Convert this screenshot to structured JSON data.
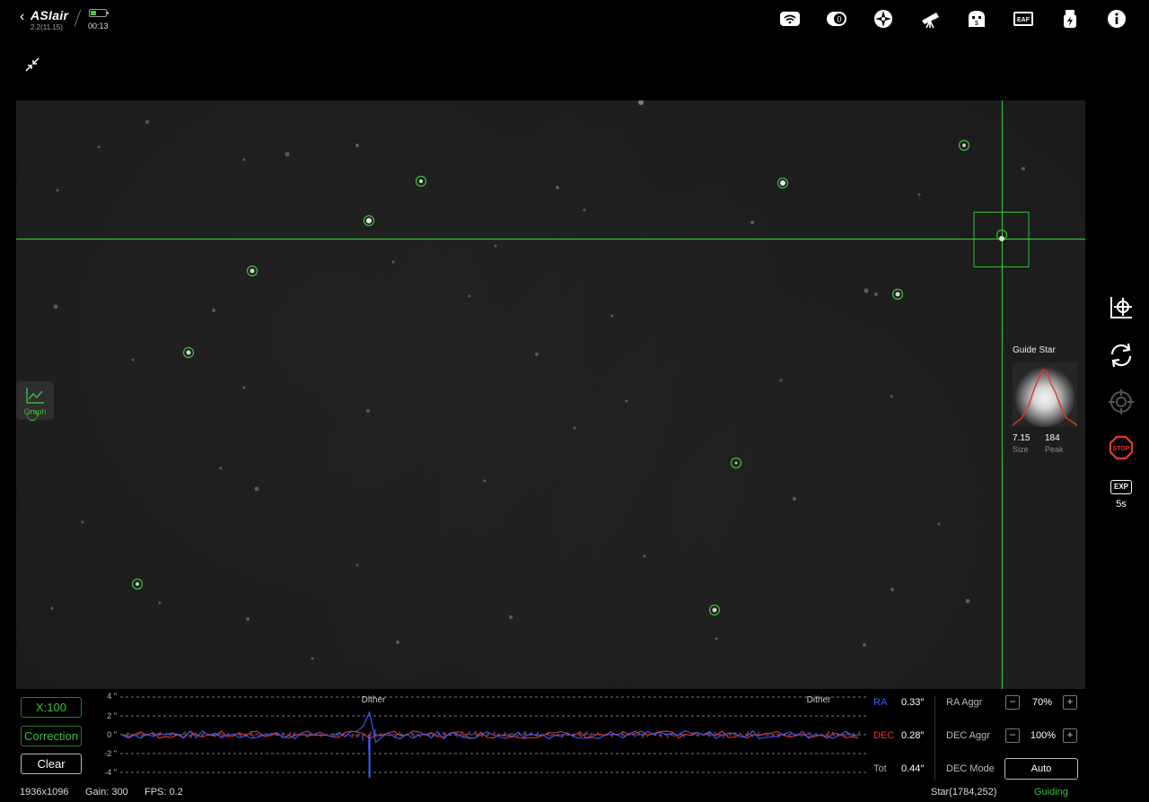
{
  "header": {
    "app_logo": "ASIair",
    "version": "2.2(11.15)",
    "elapsed": "00:13",
    "battery_level_pct": 40,
    "toolbar_icons": [
      "wifi-icon",
      "filter-wheel-icon",
      "guide-icon",
      "telescope-icon",
      "power-box-icon",
      "eaf-icon",
      "power-icon",
      "info-icon"
    ],
    "eaf_label": "EAF",
    "filter_label": "0"
  },
  "guide_view": {
    "graph_label": "Graph"
  },
  "guide_star": {
    "title": "Guide Star",
    "size_value": "7.15",
    "size_label": "Size",
    "peak_value": "184",
    "peak_label": "Peak"
  },
  "right_toolbar": {
    "items": [
      "calibrate-icon",
      "loop-icon",
      "target-icon",
      "stop-icon"
    ],
    "stop_label": "STOP",
    "exp_label": "EXP",
    "exp_value": "5s"
  },
  "graph_panel": {
    "scale_button": "X:100",
    "correction_button": "Correction",
    "clear_button": "Clear",
    "y_ticks": [
      "4 \"",
      "2 \"",
      "0 \"",
      "-2 \"",
      "-4 \""
    ],
    "dither_labels": [
      "Dither",
      "Dither"
    ],
    "colors": {
      "ra": "#3e5bff",
      "dec": "#e0362c",
      "grid": "#777777"
    }
  },
  "stats": {
    "ra_label": "RA",
    "ra_value": "0.33″",
    "dec_label": "DEC",
    "dec_value": "0.28″",
    "tot_label": "Tot",
    "tot_value": "0.44″"
  },
  "controls": {
    "ra_aggr_label": "RA Aggr",
    "ra_aggr_value": "70%",
    "dec_aggr_label": "DEC Aggr",
    "dec_aggr_value": "100%",
    "dec_mode_label": "DEC Mode",
    "dec_mode_value": "Auto",
    "minus": "−",
    "plus": "+"
  },
  "status_bar": {
    "resolution": "1936x1096",
    "gain": "Gain: 300",
    "fps": "FPS: 0.2",
    "star": "Star(1784,252)",
    "state": "Guiding"
  }
}
